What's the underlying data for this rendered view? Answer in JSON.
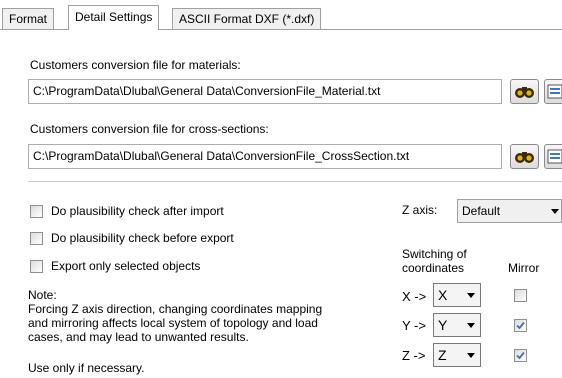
{
  "tabs": [
    "Format",
    "Detail Settings",
    "ASCII Format DXF (*.dxf)"
  ],
  "materials": {
    "label": "Customers conversion file for materials:",
    "path": "C:\\ProgramData\\Dlubal\\General Data\\ConversionFile_Material.txt",
    "icons": [
      "binoculars-icon",
      "edit-file-icon"
    ]
  },
  "cross_sections": {
    "label": "Customers conversion file for cross-sections:",
    "path": "C:\\ProgramData\\Dlubal\\General Data\\ConversionFile_CrossSection.txt",
    "icons": [
      "binoculars-icon",
      "edit-file-icon"
    ]
  },
  "options": [
    {
      "label": "Do plausibility check after import",
      "checked": false
    },
    {
      "label": "Do plausibility check before export",
      "checked": false
    },
    {
      "label": "Export only selected objects",
      "checked": false
    }
  ],
  "note": {
    "title": "Note:",
    "lines": [
      "Forcing Z axis direction, changing coordinates mapping",
      "and mirroring affects local system of topology and load",
      "cases, and may lead to unwanted results."
    ],
    "footer": "Use only if necessary."
  },
  "z_axis": {
    "label": "Z axis:",
    "value": "Default"
  },
  "switching": {
    "header_line1": "Switching of",
    "header_line2": "coordinates",
    "mirror_header": "Mirror",
    "rows": [
      {
        "from": "X ->",
        "value": "X",
        "mirror": false
      },
      {
        "from": "Y ->",
        "value": "Y",
        "mirror": true
      },
      {
        "from": "Z ->",
        "value": "Z",
        "mirror": true
      }
    ]
  },
  "colors": {
    "tab_border": "#a0a0a0",
    "check": "#4a6ea9"
  }
}
